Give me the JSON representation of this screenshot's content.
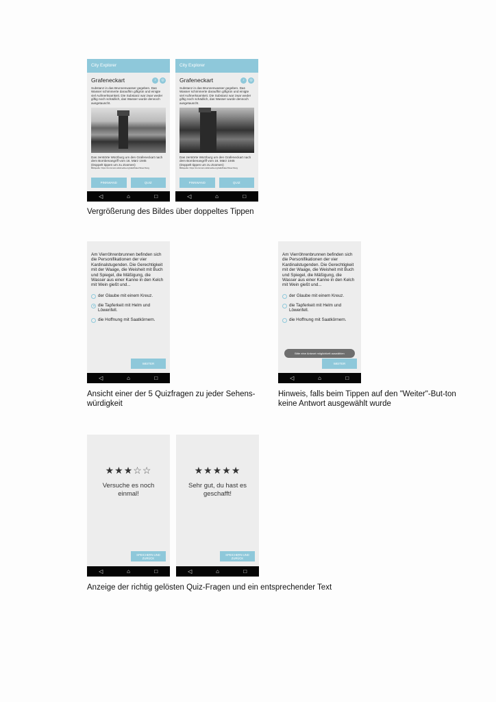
{
  "app": {
    "name": "City Explorer",
    "poi_title": "Grafeneckart"
  },
  "nav": {
    "back": "◁",
    "home": "⌂",
    "recent": "□"
  },
  "detail": {
    "text_top": "Substanz in das Brunnenwasser gegeben. Das Wasser schimmerte daraufhin giftgrün und einigte viel Aufmerksamkeit. Die Substanz war zwar weder giftig noch schädlich, das Wasser wurde dennoch ausgetauscht.",
    "photo_caption": "Das zerstörte Würzburg um den Grafeneckart nach dem Bombenangriff vom 16. März 1945",
    "zoom_hint": "(Doppelt tippen um zu Zoomen)",
    "source": "Bildquelle: https://commons.wikimedia.org/wiki/Datei:Wuerzburg",
    "btn_pinboard": "PINNWAND",
    "btn_quiz": "QUIZ"
  },
  "quiz": {
    "question": "Am Vierröhrenbrunnen befinden sich die Personifikationen der vier Kardinalstugenden. Die Gerechtigkeit mit der Waage, die Weisheit mit Buch und Spiegel, die Mäßigung, die Wasser aus einer Kanne in den Kelch mit Wein gießt und...",
    "options": [
      "der Glaube mit einem Kreuz.",
      "die Tapferkeit mit Helm und Löwenfell.",
      "die Hoffnung mit Saatkörnern."
    ],
    "next": "WEITER",
    "toast": "Bitte eine Antwort möglichkeit auswählen"
  },
  "results": [
    {
      "stars": 3,
      "of": 5,
      "text": "Versuche es noch einmal!"
    },
    {
      "stars": 5,
      "of": 5,
      "text": "Sehr gut, du hast es geschafft!"
    }
  ],
  "save_btn": "SPEICHERN UND ZURÜCK",
  "captions": {
    "zoom": "Vergrößerung des Bildes über doppeltes Tippen",
    "quiz_view": "Ansicht einer der 5 Quizfragen zu jeder Sehens-würdigkeit",
    "hint": "Hinweis, falls beim Tippen auf den \"Weiter\"-But-ton keine Antwort ausgewählt wurde",
    "results": "Anzeige der richtig gelösten Quiz-Fragen und ein entsprechender Text"
  }
}
